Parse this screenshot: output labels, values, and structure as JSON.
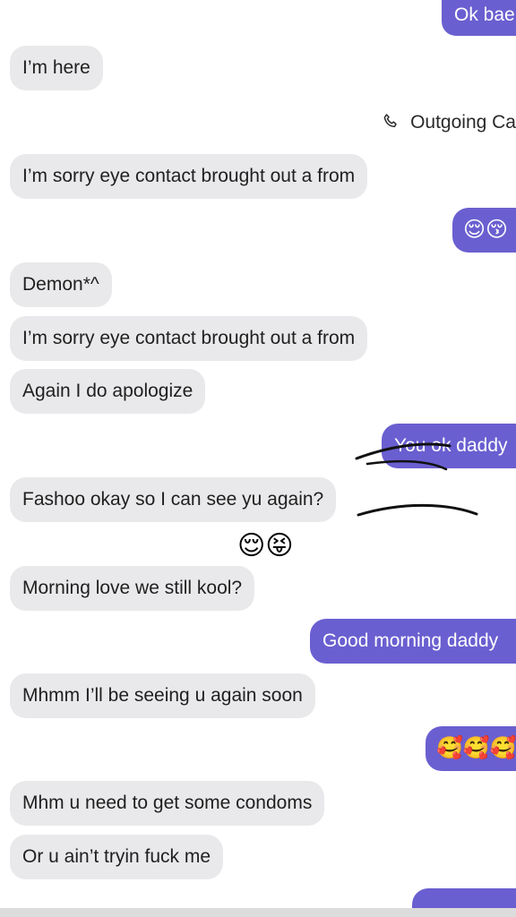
{
  "messages": [
    {
      "id": "m0",
      "dir": "out",
      "text": "Ok bae"
    },
    {
      "id": "m1",
      "dir": "in",
      "text": "I’m here"
    },
    {
      "id": "m2",
      "dir": "in",
      "text": "I’m sorry eye contact brought out a from"
    },
    {
      "id": "m3",
      "dir": "out",
      "text": "😌😚"
    },
    {
      "id": "m4",
      "dir": "in",
      "text": "Demon*^"
    },
    {
      "id": "m5",
      "dir": "in",
      "text": "I’m sorry eye contact brought out a from"
    },
    {
      "id": "m6",
      "dir": "in",
      "text": "Again I do apologize"
    },
    {
      "id": "m7",
      "dir": "out",
      "text": "You ok daddy"
    },
    {
      "id": "m8",
      "dir": "in",
      "text": "Fashoo okay so I can see yu again?"
    },
    {
      "id": "m9",
      "dir": "in",
      "text": "Morning love we still kool?"
    },
    {
      "id": "m10",
      "dir": "out",
      "text": "Good morning daddy"
    },
    {
      "id": "m11",
      "dir": "in",
      "text": "Mhmm I’ll be seeing u again soon"
    },
    {
      "id": "m12",
      "dir": "out",
      "text": "🥰🥰🥰"
    },
    {
      "id": "m13",
      "dir": "in",
      "text": "Mhm u need to get some condoms"
    },
    {
      "id": "m14",
      "dir": "in",
      "text": "Or u ain’t tryin fuck me"
    }
  ],
  "call": {
    "label": "Outgoing Ca",
    "icon": "phone-icon"
  },
  "reaction": {
    "text": "😌😝"
  },
  "colors": {
    "incoming": "#e9e9eb",
    "outgoing": "#6a5fd0",
    "outgoing_text": "#ffffff"
  }
}
